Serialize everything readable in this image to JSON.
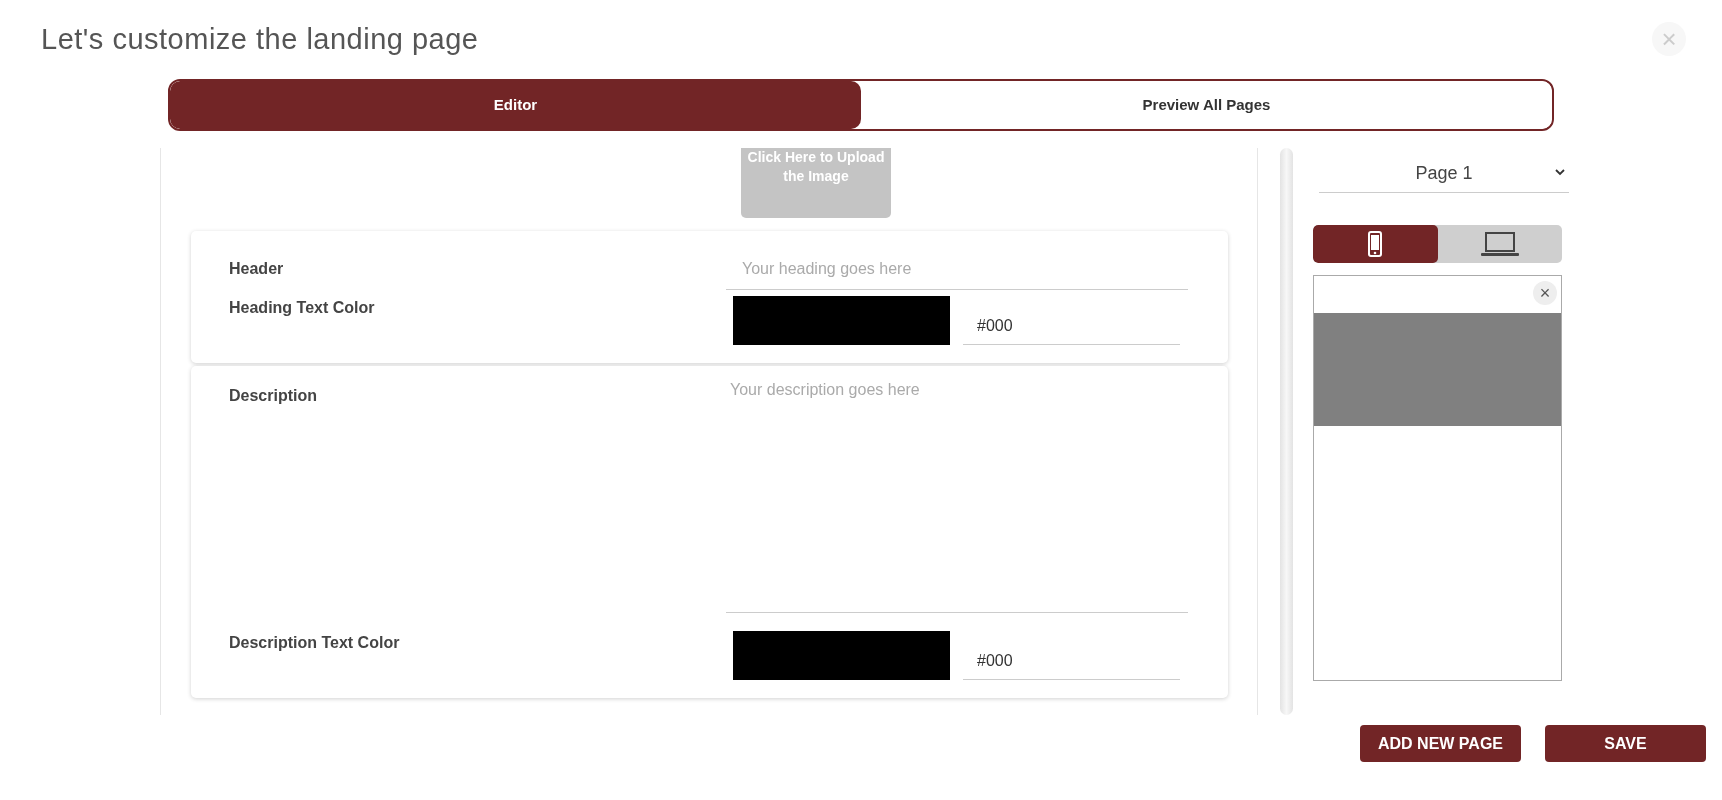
{
  "dialog": {
    "title": "Let's customize the landing page",
    "close_label": "×"
  },
  "tabs": [
    {
      "label": "Editor",
      "selected": true
    },
    {
      "label": "Preview All Pages",
      "selected": false
    }
  ],
  "upload": {
    "label": "Click Here to Upload the Image"
  },
  "sections": [
    {
      "fields": [
        {
          "kind": "text",
          "label": "Header",
          "placeholder": "Your heading goes here"
        },
        {
          "kind": "color",
          "label": "Heading Text Color",
          "color": "#000000",
          "value": "#000"
        }
      ]
    },
    {
      "fields": [
        {
          "kind": "textarea",
          "label": "Description",
          "placeholder": "Your description goes here"
        },
        {
          "kind": "color",
          "label": "Description Text Color",
          "color": "#000000",
          "value": "#000"
        }
      ]
    }
  ],
  "page_select": {
    "value": "Page 1"
  },
  "devices": [
    {
      "kind": "phone",
      "selected": true
    },
    {
      "kind": "laptop",
      "selected": false
    }
  ],
  "preview": {
    "close_label": "×"
  },
  "buttons": [
    "ADD NEW PAGE",
    "SAVE"
  ]
}
